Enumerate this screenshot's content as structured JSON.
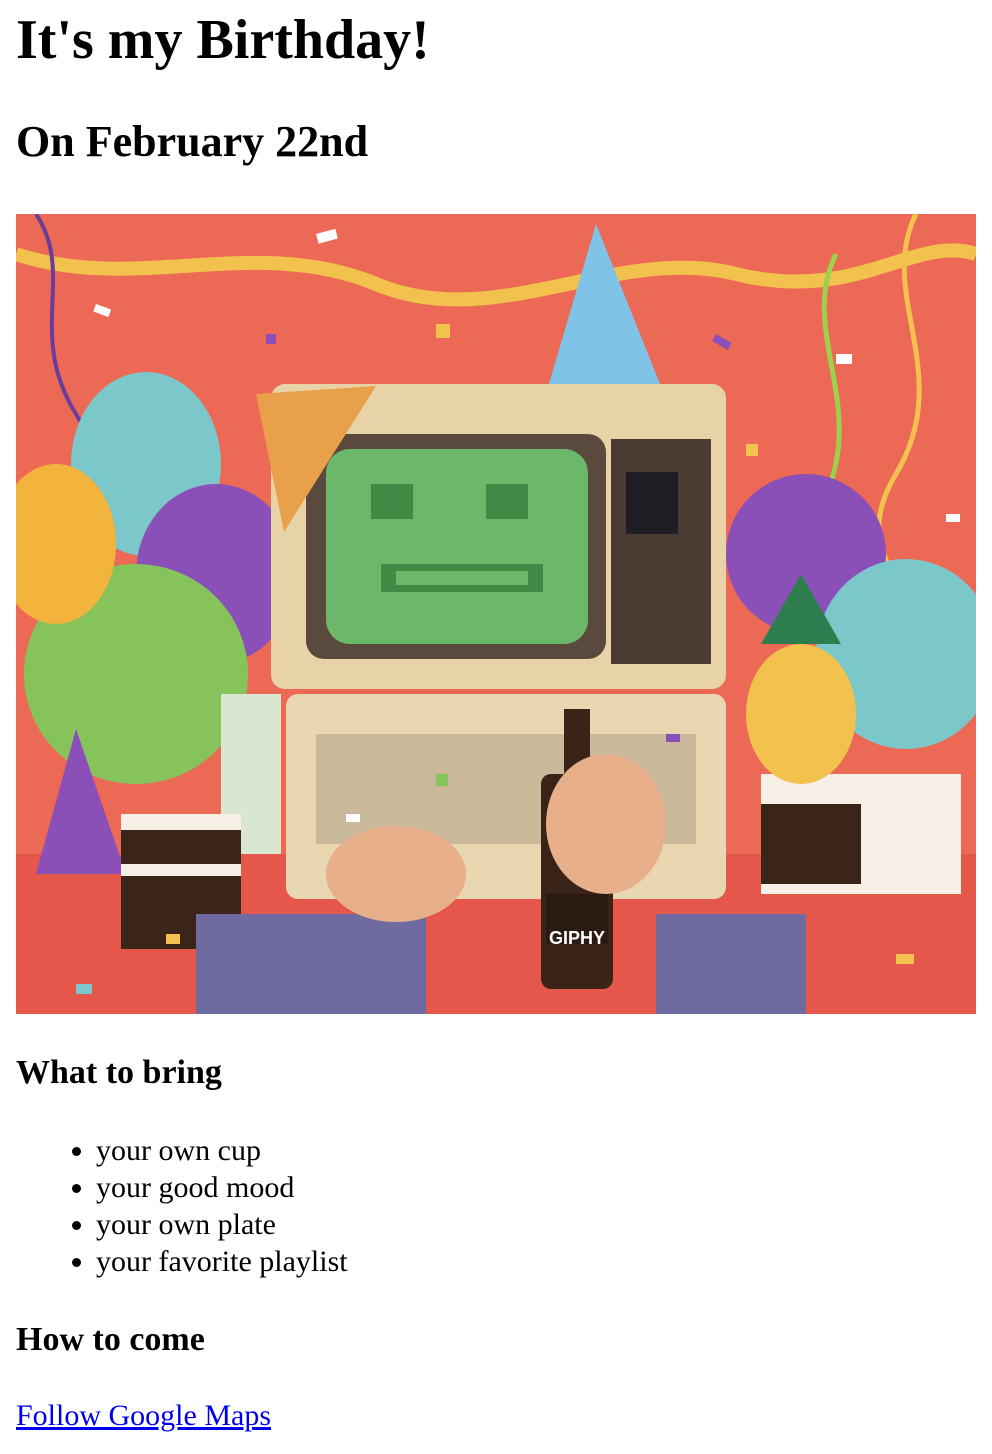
{
  "page": {
    "title": "It's my Birthday!",
    "subtitle": "On February 22nd"
  },
  "hero_image": {
    "description_icon": "party-computer-gif",
    "watermark": "GIPHY"
  },
  "bring": {
    "heading": "What to bring",
    "items": [
      "your own cup",
      "your good mood",
      "your own plate",
      "your favorite playlist"
    ]
  },
  "come": {
    "heading": "How to come",
    "link_label": "Follow Google Maps"
  },
  "colors": {
    "link": "#0000ee",
    "text": "#000000",
    "background": "#ffffff"
  }
}
